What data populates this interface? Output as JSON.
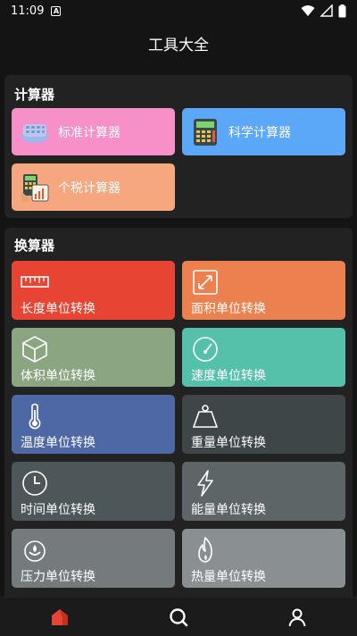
{
  "status_bar": {
    "time": "11:09",
    "notification_letter": "A"
  },
  "header": {
    "title": "工具大全"
  },
  "calculators": {
    "title": "计算器",
    "items": [
      {
        "label": "标准计算器",
        "color": "#f78fc9",
        "icon": "standard-calculator-icon"
      },
      {
        "label": "科学计算器",
        "color": "#5aa8f7",
        "icon": "scientific-calculator-icon"
      },
      {
        "label": "个税计算器",
        "color": "#f6a77f",
        "icon": "tax-calculator-icon"
      }
    ]
  },
  "converters": {
    "title": "换算器",
    "items": [
      {
        "label": "长度单位转换",
        "color": "#e84433",
        "icon": "ruler-icon"
      },
      {
        "label": "面积单位转换",
        "color": "#ec814f",
        "icon": "area-expand-icon"
      },
      {
        "label": "体积单位转换",
        "color": "#8aa57f",
        "icon": "cube-icon"
      },
      {
        "label": "速度单位转换",
        "color": "#56c1ab",
        "icon": "speedometer-icon"
      },
      {
        "label": "温度单位转换",
        "color": "#4d68a4",
        "icon": "thermometer-icon"
      },
      {
        "label": "重量单位转换",
        "color": "#3e4648",
        "icon": "weight-icon"
      },
      {
        "label": "时间单位转换",
        "color": "#4d5658",
        "icon": "clock-icon"
      },
      {
        "label": "能量单位转换",
        "color": "#5e6567",
        "icon": "lightning-icon"
      },
      {
        "label": "压力单位转换",
        "color": "#757b7d",
        "icon": "pressure-icon"
      },
      {
        "label": "热量单位转换",
        "color": "#8a9092",
        "icon": "flame-icon"
      }
    ]
  },
  "bottom_nav": {
    "active_color": "#e84433",
    "items": [
      {
        "icon": "home-icon",
        "active": true
      },
      {
        "icon": "search-icon",
        "active": false
      },
      {
        "icon": "profile-icon",
        "active": false
      }
    ]
  }
}
